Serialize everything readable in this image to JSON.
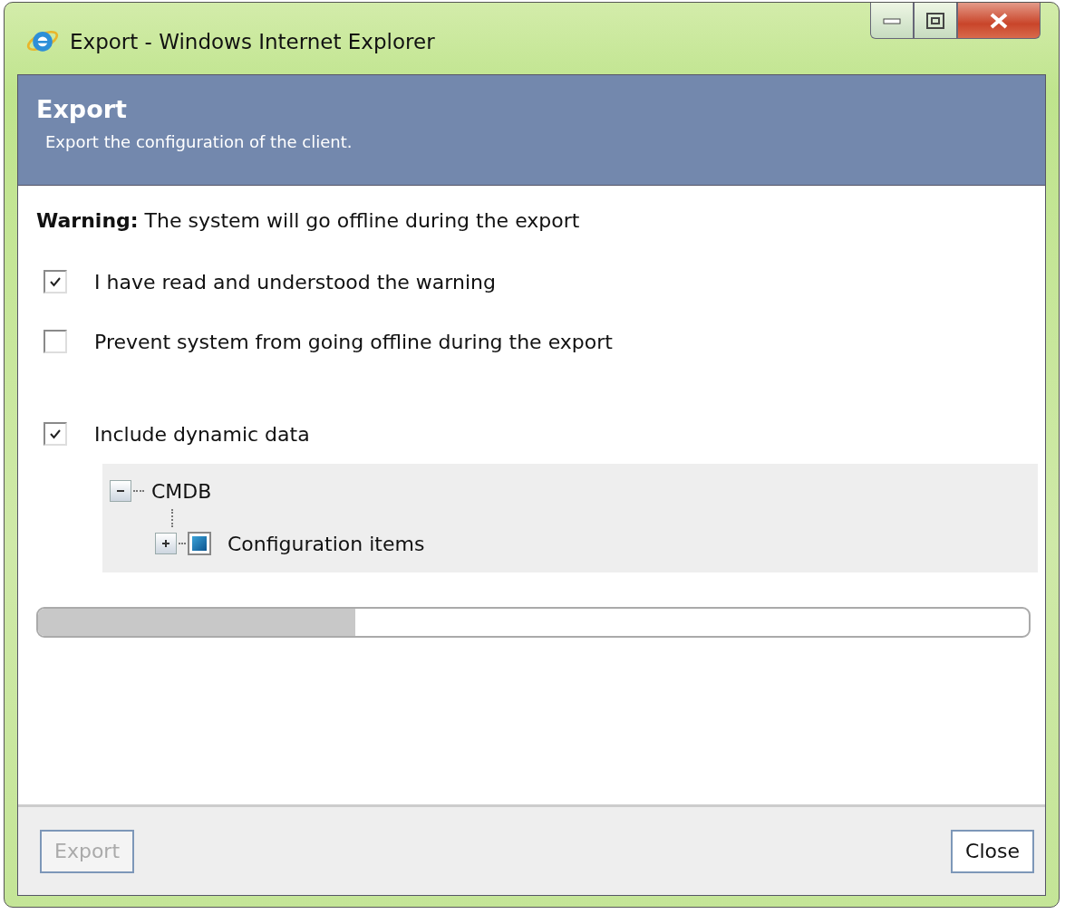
{
  "window": {
    "title": "Export - Windows Internet Explorer"
  },
  "header": {
    "title": "Export",
    "subtitle": "Export the configuration of the client."
  },
  "warning": "**Warning:** The system will go offline during the export",
  "options": [
    {
      "label": "I have read and understood the warning",
      "checked": true
    },
    {
      "label": "Prevent system from going offline during the export",
      "checked": false
    },
    {
      "label": "Include dynamic data",
      "checked": true
    }
  ],
  "tree": [
    {
      "label": "CMDB",
      "expanded": true,
      "children": [
        {
          "label": "Configuration items",
          "expanded": false
        }
      ]
    }
  ],
  "progress": {
    "level": 0.32
  },
  "buttons": [
    {
      "label": "Export",
      "disabled": true
    },
    {
      "label": "Close",
      "disabled": false
    }
  ]
}
